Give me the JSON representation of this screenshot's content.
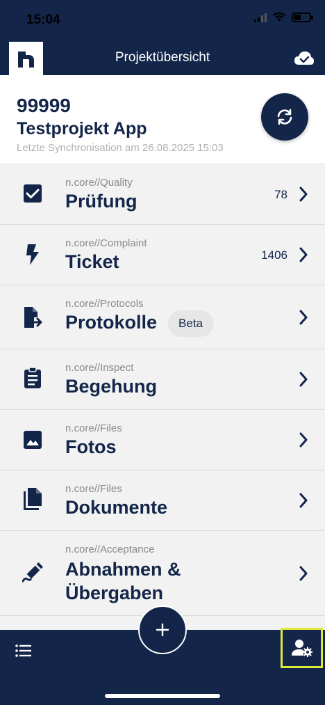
{
  "status_bar": {
    "time": "15:04"
  },
  "nav": {
    "title": "Projektübersicht"
  },
  "project": {
    "number": "99999",
    "name": "Testprojekt App",
    "last_sync": "Letzte Synchronisation am 26.08.2025 15:03"
  },
  "modules": [
    {
      "subtitle": "n.core//Quality",
      "title": "Prüfung",
      "count": "78",
      "icon": "check-box-icon"
    },
    {
      "subtitle": "n.core//Complaint",
      "title": "Ticket",
      "count": "1406",
      "icon": "lightning-icon"
    },
    {
      "subtitle": "n.core//Protocols",
      "title": "Protokolle",
      "badge": "Beta",
      "icon": "file-export-icon"
    },
    {
      "subtitle": "n.core//Inspect",
      "title": "Begehung",
      "icon": "clipboard-icon"
    },
    {
      "subtitle": "n.core//Files",
      "title": "Fotos",
      "icon": "image-icon"
    },
    {
      "subtitle": "n.core//Files",
      "title": "Dokumente",
      "icon": "documents-icon"
    },
    {
      "subtitle": "n.core//Acceptance",
      "title": "Abnahmen &",
      "title_line2": "Übergaben",
      "icon": "signature-icon"
    }
  ],
  "colors": {
    "primary": "#13264a",
    "background": "#f2f2f2",
    "highlight": "#dde93a"
  }
}
